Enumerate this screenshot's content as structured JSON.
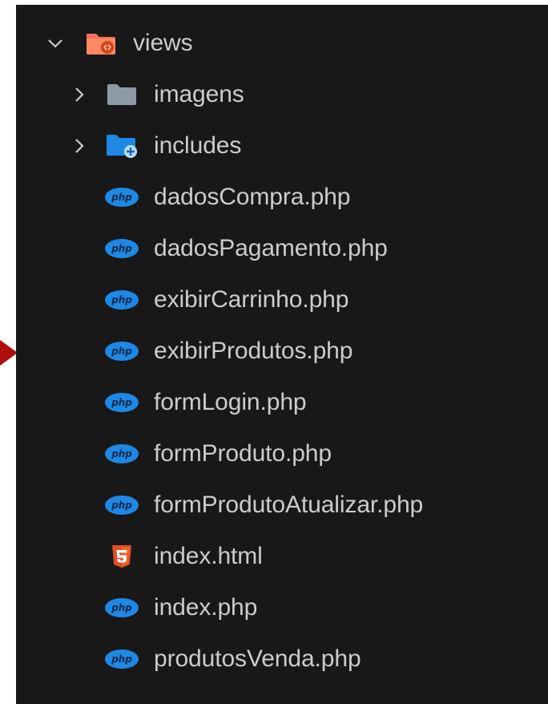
{
  "explorer": {
    "folder": {
      "name": "views",
      "expanded": true,
      "icon": "views-folder-open-icon",
      "icon_color": "#f0725a"
    },
    "items": [
      {
        "type": "folder",
        "name": "imagens",
        "expanded": false,
        "icon": "folder-icon",
        "icon_color": "#8c9aa5"
      },
      {
        "type": "folder",
        "name": "includes",
        "expanded": false,
        "icon": "folder-include-icon",
        "icon_color": "#1e88e5"
      },
      {
        "type": "file",
        "name": "dadosCompra.php",
        "icon": "php-file-icon",
        "icon_color": "#1e88e5"
      },
      {
        "type": "file",
        "name": "dadosPagamento.php",
        "icon": "php-file-icon",
        "icon_color": "#1e88e5"
      },
      {
        "type": "file",
        "name": "exibirCarrinho.php",
        "icon": "php-file-icon",
        "icon_color": "#1e88e5"
      },
      {
        "type": "file",
        "name": "exibirProdutos.php",
        "icon": "php-file-icon",
        "icon_color": "#1e88e5"
      },
      {
        "type": "file",
        "name": "formLogin.php",
        "icon": "php-file-icon",
        "icon_color": "#1e88e5"
      },
      {
        "type": "file",
        "name": "formProduto.php",
        "icon": "php-file-icon",
        "icon_color": "#1e88e5"
      },
      {
        "type": "file",
        "name": "formProdutoAtualizar.php",
        "icon": "php-file-icon",
        "icon_color": "#1e88e5"
      },
      {
        "type": "file",
        "name": "index.html",
        "icon": "html5-file-icon",
        "icon_color": "#e44d26"
      },
      {
        "type": "file",
        "name": "index.php",
        "icon": "php-file-icon",
        "icon_color": "#1e88e5"
      },
      {
        "type": "file",
        "name": "produtosVenda.php",
        "icon": "php-file-icon",
        "icon_color": "#1e88e5"
      }
    ]
  },
  "annotation": {
    "arrow_color": "#b00d0d"
  }
}
